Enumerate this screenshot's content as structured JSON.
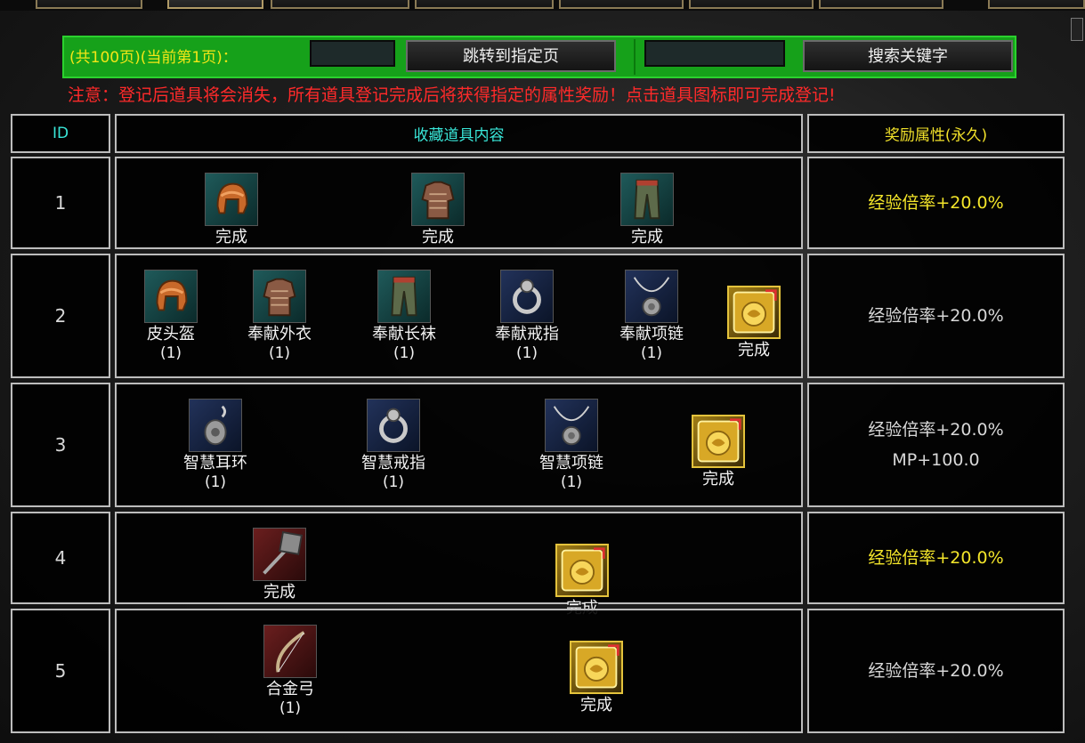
{
  "tabs": [
    "",
    "",
    "",
    "",
    "",
    "",
    "",
    ""
  ],
  "search": {
    "page_info": "(共100页)(当前第1页)：",
    "page_input_value": "",
    "jump_button": "跳转到指定页",
    "keyword_input_value": "",
    "search_button": "搜索关键字"
  },
  "notice": "注意：登记后道具将会消失，所有道具登记完成后将获得指定的属性奖励！点击道具图标即可完成登记!",
  "table": {
    "header": {
      "id": "ID",
      "content": "收藏道具内容",
      "reward": "奖励属性(永久)"
    },
    "rows": [
      {
        "id": "1",
        "reward_lines": [
          "经验倍率+20.0%"
        ],
        "reward_highlight": true,
        "items": [
          {
            "label": "完成",
            "count": "",
            "icon": "helmet-icon"
          },
          {
            "label": "完成",
            "count": "",
            "icon": "armor-icon"
          },
          {
            "label": "完成",
            "count": "",
            "icon": "pants-icon"
          }
        ]
      },
      {
        "id": "2",
        "reward_lines": [
          "经验倍率+20.0%"
        ],
        "reward_highlight": false,
        "items": [
          {
            "label": "皮头盔",
            "count": "(1)",
            "icon": "helmet-icon"
          },
          {
            "label": "奉献外衣",
            "count": "(1)",
            "icon": "armor-icon"
          },
          {
            "label": "奉献长袜",
            "count": "(1)",
            "icon": "pants-icon"
          },
          {
            "label": "奉献戒指",
            "count": "(1)",
            "icon": "ring-icon"
          },
          {
            "label": "奉献项链",
            "count": "(1)",
            "icon": "necklace-icon"
          },
          {
            "label": "完成",
            "count": "",
            "icon": "gold-reward-icon"
          }
        ]
      },
      {
        "id": "3",
        "reward_lines": [
          "经验倍率+20.0%",
          "MP+100.0"
        ],
        "reward_highlight": false,
        "items": [
          {
            "label": "智慧耳环",
            "count": "(1)",
            "icon": "earring-icon"
          },
          {
            "label": "智慧戒指",
            "count": "(1)",
            "icon": "ring-icon"
          },
          {
            "label": "智慧项链",
            "count": "(1)",
            "icon": "necklace-icon"
          },
          {
            "label": "完成",
            "count": "",
            "icon": "gold-reward-icon"
          }
        ]
      },
      {
        "id": "4",
        "reward_lines": [
          "经验倍率+20.0%"
        ],
        "reward_highlight": true,
        "items": [
          {
            "label": "完成",
            "count": "",
            "icon": "staff-icon"
          },
          {
            "label": "完成",
            "count": "",
            "icon": "gold-reward-icon"
          }
        ]
      },
      {
        "id": "5",
        "reward_lines": [
          "经验倍率+20.0%"
        ],
        "reward_highlight": false,
        "items": [
          {
            "label": "合金弓",
            "count": "(1)",
            "icon": "bow-icon"
          },
          {
            "label": "完成",
            "count": "",
            "icon": "gold-reward-icon"
          }
        ]
      }
    ]
  },
  "colors": {
    "bar_green": "#16a11a",
    "notice_red": "#ff2a2a",
    "gold_text": "#f4e62a",
    "cyan_text": "#39e6d8"
  }
}
